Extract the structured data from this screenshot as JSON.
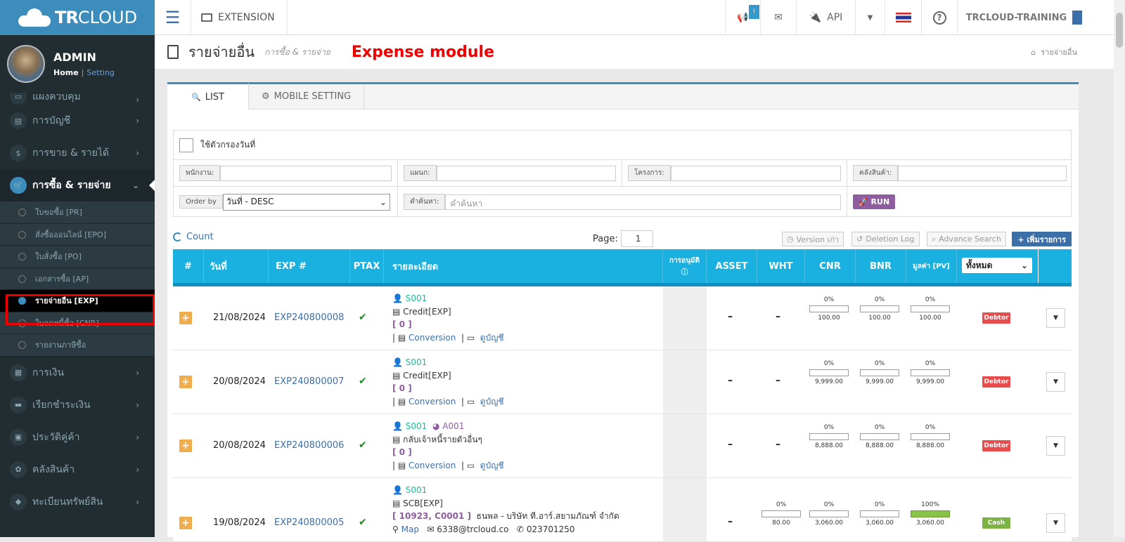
{
  "topbar": {
    "brand_bold": "TR",
    "brand_rest": "CLOUD",
    "extension_label": "EXTENSION",
    "notification_badge": "!",
    "api_label": "API",
    "account_label": "TRCLOUD-TRAINING"
  },
  "user": {
    "name": "ADMIN",
    "home_link": "Home",
    "sep": "|",
    "setting_link": "Setting"
  },
  "sidebar": {
    "menu_top": [
      {
        "label": "แผงควบคุม",
        "icon": "▭"
      },
      {
        "label": "การบัญชี",
        "icon": "▤"
      },
      {
        "label": "การขาย & รายได้",
        "icon": "$"
      }
    ],
    "active_menu": {
      "label": "การซื้อ & รายจ่าย",
      "icon": "🛒"
    },
    "submenu": [
      "ใบขอซื้อ [PR]",
      "สั่งซื้อออนไลน์ [EPO]",
      "ใบสั่งซื้อ [PO]",
      "เอกสารซื้อ [AP]",
      "รายจ่ายอื่น [EXP]",
      "ใบลดหนี้ซื้อ [CNR]",
      "รายงานภาษีซื้อ"
    ],
    "menu_bottom": [
      {
        "label": "การเงิน",
        "icon": "▦"
      },
      {
        "label": "เรียกชำระเงิน",
        "icon": "▬"
      },
      {
        "label": "ประวัติคู่ค้า",
        "icon": "▣"
      },
      {
        "label": "คลังสินค้า",
        "icon": "✿"
      },
      {
        "label": "ทะเบียนทรัพย์สิน",
        "icon": "◆"
      }
    ]
  },
  "header": {
    "title": "รายจ่ายอื่น",
    "subtitle": "การซื้อ & รายจ่าย",
    "module_note": "Expense module",
    "crumb": "รายจ่ายอื่น"
  },
  "tabs": [
    {
      "label": "LIST",
      "icon": "🔍"
    },
    {
      "label": "MOBILE SETTING",
      "icon": "⚙"
    }
  ],
  "filter": {
    "date_filter_label": "ใช้ตัวกรองวันที่",
    "employee_label": "พนักงาน:",
    "department_label": "แผนก:",
    "project_label": "โครงการ:",
    "warehouse_label": "คลังสินค้า:",
    "order_by_label": "Order by",
    "order_by_value": "วันที่ - DESC",
    "search_label": "คำค้นหา:",
    "search_placeholder": "คำค้นหา",
    "run_label": "RUN"
  },
  "toolbar": {
    "count_label": "Count",
    "page_label": "Page:",
    "page_value": "1",
    "version_btn": "Version เก่า",
    "deletion_btn": "Deletion Log",
    "advance_btn": "Advance Search",
    "add_btn": "+ เพิ่มรายการ"
  },
  "table": {
    "headers": {
      "num": "#",
      "date": "วันที่",
      "exp": "EXP #",
      "ptax": "PTAX",
      "detail": "รายละเอียด",
      "approve": "การอนุมัติ",
      "asset": "ASSET",
      "wht": "WHT",
      "cnr": "CNR",
      "bnr": "BNR",
      "pv": "มูลค่า [PV]",
      "filter_value": "ทั้งหมด"
    },
    "rows": [
      {
        "date": "21/08/2024",
        "exp": "EXP240800008",
        "supplier": "S001",
        "extra": "",
        "account": "Credit[EXP]",
        "ref": "[ 0 ]",
        "ref_name": "",
        "links": [
          "Conversion",
          "ดูบัญชี"
        ],
        "asset": "–",
        "wht_pct": "",
        "wht_val": "",
        "wht": "–",
        "cnr_pct": "0%",
        "cnr_val": "100.00",
        "bnr_pct": "0%",
        "bnr_val": "100.00",
        "pv_pct": "0%",
        "pv_val": "100.00",
        "pv_progress": 0,
        "status": "Debtor",
        "status_color": "#e84c4c"
      },
      {
        "date": "20/08/2024",
        "exp": "EXP240800007",
        "supplier": "S001",
        "extra": "",
        "account": "Credit[EXP]",
        "ref": "[ 0 ]",
        "ref_name": "",
        "links": [
          "Conversion",
          "ดูบัญชี"
        ],
        "asset": "–",
        "wht_pct": "",
        "wht_val": "",
        "wht": "–",
        "cnr_pct": "0%",
        "cnr_val": "9,999.00",
        "bnr_pct": "0%",
        "bnr_val": "9,999.00",
        "pv_pct": "0%",
        "pv_val": "9,999.00",
        "pv_progress": 0,
        "status": "Debtor",
        "status_color": "#e84c4c"
      },
      {
        "date": "20/08/2024",
        "exp": "EXP240800006",
        "supplier": "S001",
        "extra": "A001",
        "account": "กลับเจ้าหนี้รายตัวอื่นๆ",
        "ref": "[ 0 ]",
        "ref_name": "",
        "links": [
          "Conversion",
          "ดูบัญชี"
        ],
        "asset": "–",
        "wht_pct": "",
        "wht_val": "",
        "wht": "–",
        "cnr_pct": "0%",
        "cnr_val": "8,888.00",
        "bnr_pct": "0%",
        "bnr_val": "8,888.00",
        "pv_pct": "0%",
        "pv_val": "8,888.00",
        "pv_progress": 0,
        "status": "Debtor",
        "status_color": "#e84c4c"
      },
      {
        "date": "19/08/2024",
        "exp": "EXP240800005",
        "supplier": "S001",
        "extra": "",
        "account": "SCB[EXP]",
        "ref": "[ 10923, C0001 ]",
        "ref_name": "ธนพล - บริษัท ที.อาร์.สยามภัณฑ์ จำกัด",
        "links": [
          "Map",
          "6338@trcloud.co",
          "023701250"
        ],
        "asset": "–",
        "wht_pct": "0%",
        "wht_val": "80.00",
        "wht": "",
        "cnr_pct": "0%",
        "cnr_val": "3,060.00",
        "bnr_pct": "0%",
        "bnr_val": "3,060.00",
        "pv_pct": "100%",
        "pv_val": "3,060.00",
        "pv_progress": 100,
        "status": "Cash",
        "status_color": "#7cb342"
      }
    ]
  }
}
